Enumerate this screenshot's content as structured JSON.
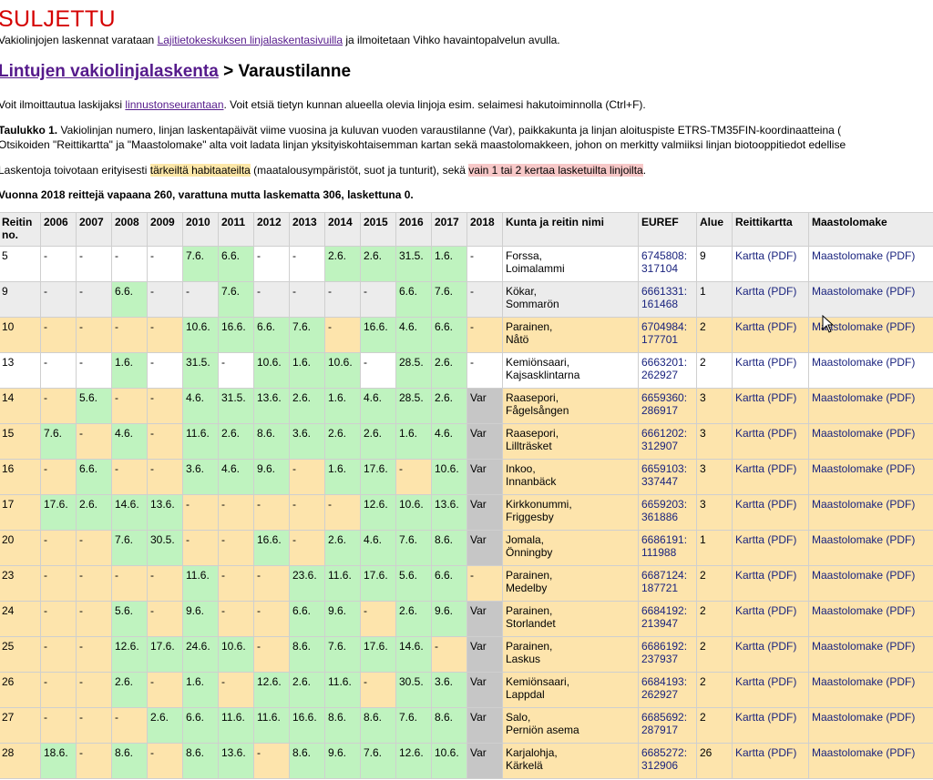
{
  "status": "SULJETTU",
  "intro": {
    "before": "Vakiolinjojen laskennat varataan ",
    "link": "Lajitietokeskuksen linjalaskentasivuilla",
    "after": " ja ilmoitetaan Vihko havaintopalvelun avulla."
  },
  "breadcrumb": {
    "link": "Lintujen vakiolinjalaskenta",
    "separator": " > ",
    "current": "Varaustilanne"
  },
  "info1": {
    "before": "Voit ilmoittautua laskijaksi ",
    "link": "linnustonseurantaan",
    "after": ". Voit etsiä tietyn kunnan alueella olevia linjoja esim. selaimesi hakutoiminnolla (Ctrl+F)."
  },
  "info2": {
    "bold": "Taulukko 1.",
    "line1": " Vakiolinjan numero, linjan laskentapäivät viime vuosina ja kuluvan vuoden varaustilanne (Var), paikkakunta ja linjan aloituspiste ETRS-TM35FIN-koordinaatteina (",
    "line2": "Otsikoiden \"Reittikartta\" ja \"Maastolomake\" alta voit ladata linjan yksityiskohtaisemman kartan sekä maastolomakkeen, johon on merkitty valmiiksi linjan biotooppitiedot edellise"
  },
  "info3": {
    "before": "Laskentoja toivotaan erityisesti ",
    "yellow": "tärkeiltä habitaateilta",
    "middle": " (maatalousympäristöt, suot ja tunturit), sekä ",
    "red": "vain 1 tai 2 kertaa lasketuilta linjoilta",
    "after": "."
  },
  "summary": "Vuonna 2018 reittejä vapaana 260, varattuna mutta laskematta 306, laskettuna 0.",
  "colors": {
    "white": "#ffffff",
    "orange": "#fde4ac",
    "green": "#bff3bf",
    "grey": "#c6c6c6",
    "lightgrey": "#ececec"
  },
  "table": {
    "headers": [
      "Reitin no.",
      "2006",
      "2007",
      "2008",
      "2009",
      "2010",
      "2011",
      "2012",
      "2013",
      "2014",
      "2015",
      "2016",
      "2017",
      "2018",
      "Kunta ja reitin nimi",
      "EUREF",
      "Alue",
      "Reittikartta",
      "Maastolomake"
    ],
    "map_link": "Kartta (PDF)",
    "form_link": "Maastolomake (PDF)",
    "rows": [
      {
        "no": "5",
        "bg": "white",
        "years": [
          "-",
          "-",
          "-",
          "-",
          "7.6.",
          "6.6.",
          "-",
          "-",
          "2.6.",
          "2.6.",
          "31.5.",
          "1.6.",
          "-"
        ],
        "place": "Forssa,",
        "name": "Loimalammi",
        "e1": "6745808:",
        "e2": "317104",
        "area": "9"
      },
      {
        "no": "9",
        "bg": "lightgrey",
        "years": [
          "-",
          "-",
          "6.6.",
          "-",
          "-",
          "7.6.",
          "-",
          "-",
          "-",
          "-",
          "6.6.",
          "7.6.",
          "-"
        ],
        "place": "Kökar,",
        "name": "Sommarön",
        "e1": "6661331:",
        "e2": "161468",
        "area": "1"
      },
      {
        "no": "10",
        "bg": "orange",
        "years": [
          "-",
          "-",
          "-",
          "-",
          "10.6.",
          "16.6.",
          "6.6.",
          "7.6.",
          "-",
          "16.6.",
          "4.6.",
          "6.6.",
          "-"
        ],
        "place": "Parainen,",
        "name": "Nåtö",
        "e1": "6704984:",
        "e2": "177701",
        "area": "2"
      },
      {
        "no": "13",
        "bg": "white",
        "years": [
          "-",
          "-",
          "1.6.",
          "-",
          "31.5.",
          "-",
          "10.6.",
          "1.6.",
          "10.6.",
          "-",
          "28.5.",
          "2.6.",
          "-"
        ],
        "place": "Kemiönsaari,",
        "name": "Kajsasklintarna",
        "e1": "6663201:",
        "e2": "262927",
        "area": "2"
      },
      {
        "no": "14",
        "bg": "orange",
        "years": [
          "-",
          "5.6.",
          "-",
          "-",
          "4.6.",
          "31.5.",
          "13.6.",
          "2.6.",
          "1.6.",
          "4.6.",
          "28.5.",
          "2.6.",
          "Var"
        ],
        "place": "Raasepori,",
        "name": "Fågelsången",
        "e1": "6659360:",
        "e2": "286917",
        "area": "3"
      },
      {
        "no": "15",
        "bg": "orange",
        "years": [
          "7.6.",
          "-",
          "4.6.",
          "-",
          "11.6.",
          "2.6.",
          "8.6.",
          "3.6.",
          "2.6.",
          "2.6.",
          "1.6.",
          "4.6.",
          "Var"
        ],
        "place": "Raasepori,",
        "name": "Lillträsket",
        "e1": "6661202:",
        "e2": "312907",
        "area": "3"
      },
      {
        "no": "16",
        "bg": "orange",
        "years": [
          "-",
          "6.6.",
          "-",
          "-",
          "3.6.",
          "4.6.",
          "9.6.",
          "-",
          "1.6.",
          "17.6.",
          "-",
          "10.6.",
          "Var"
        ],
        "place": "Inkoo,",
        "name": "Innanbäck",
        "e1": "6659103:",
        "e2": "337447",
        "area": "3"
      },
      {
        "no": "17",
        "bg": "orange",
        "years": [
          "17.6.",
          "2.6.",
          "14.6.",
          "13.6.",
          "-",
          "-",
          "-",
          "-",
          "-",
          "12.6.",
          "10.6.",
          "13.6.",
          "Var"
        ],
        "place": "Kirkkonummi,",
        "name": "Friggesby",
        "e1": "6659203:",
        "e2": "361886",
        "area": "3"
      },
      {
        "no": "20",
        "bg": "orange",
        "years": [
          "-",
          "-",
          "7.6.",
          "30.5.",
          "-",
          "-",
          "16.6.",
          "-",
          "2.6.",
          "4.6.",
          "7.6.",
          "8.6.",
          "Var"
        ],
        "place": "Jomala,",
        "name": "Önningby",
        "e1": "6686191:",
        "e2": "111988",
        "area": "1"
      },
      {
        "no": "23",
        "bg": "orange",
        "years": [
          "-",
          "-",
          "-",
          "-",
          "11.6.",
          "-",
          "-",
          "23.6.",
          "11.6.",
          "17.6.",
          "5.6.",
          "6.6.",
          "-"
        ],
        "place": "Parainen,",
        "name": "Medelby",
        "e1": "6687124:",
        "e2": "187721",
        "area": "2"
      },
      {
        "no": "24",
        "bg": "orange",
        "years": [
          "-",
          "-",
          "5.6.",
          "-",
          "9.6.",
          "-",
          "-",
          "6.6.",
          "9.6.",
          "-",
          "2.6.",
          "9.6.",
          "Var"
        ],
        "place": "Parainen,",
        "name": "Storlandet",
        "e1": "6684192:",
        "e2": "213947",
        "area": "2"
      },
      {
        "no": "25",
        "bg": "orange",
        "years": [
          "-",
          "-",
          "12.6.",
          "17.6.",
          "24.6.",
          "10.6.",
          "-",
          "8.6.",
          "7.6.",
          "17.6.",
          "14.6.",
          "-",
          "Var"
        ],
        "place": "Parainen,",
        "name": "Laskus",
        "e1": "6686192:",
        "e2": "237937",
        "area": "2"
      },
      {
        "no": "26",
        "bg": "orange",
        "years": [
          "-",
          "-",
          "2.6.",
          "-",
          "1.6.",
          "-",
          "12.6.",
          "2.6.",
          "11.6.",
          "-",
          "30.5.",
          "3.6.",
          "Var"
        ],
        "place": "Kemiönsaari,",
        "name": "Lappdal",
        "e1": "6684193:",
        "e2": "262927",
        "area": "2"
      },
      {
        "no": "27",
        "bg": "orange",
        "years": [
          "-",
          "-",
          "-",
          "2.6.",
          "6.6.",
          "11.6.",
          "11.6.",
          "16.6.",
          "8.6.",
          "8.6.",
          "7.6.",
          "8.6.",
          "Var"
        ],
        "place": "Salo,",
        "name": "Perniön asema",
        "e1": "6685692:",
        "e2": "287917",
        "area": "2"
      },
      {
        "no": "28",
        "bg": "orange",
        "years": [
          "18.6.",
          "-",
          "8.6.",
          "-",
          "8.6.",
          "13.6.",
          "-",
          "8.6.",
          "9.6.",
          "7.6.",
          "12.6.",
          "10.6.",
          "Var"
        ],
        "place": "Karjalohja,",
        "name": "Kärkelä",
        "e1": "6685272:",
        "e2": "312906",
        "area": "26"
      }
    ]
  }
}
